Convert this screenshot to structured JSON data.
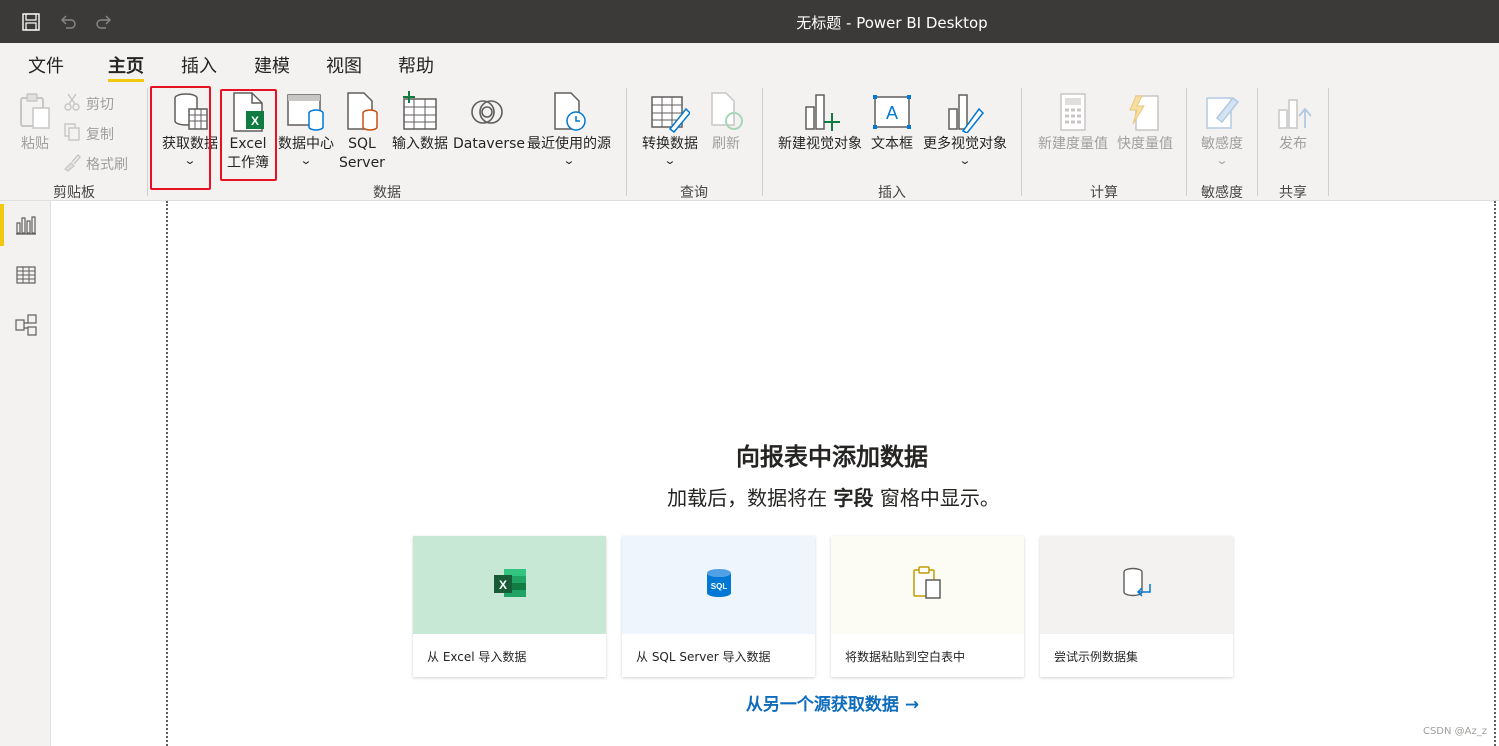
{
  "titlebar": {
    "title": "无标题 - Power BI Desktop",
    "icons": [
      "save-icon",
      "undo-icon",
      "redo-icon"
    ]
  },
  "menu": {
    "tabs": [
      "文件",
      "主页",
      "插入",
      "建模",
      "视图",
      "帮助"
    ],
    "active": "主页"
  },
  "ribbon": {
    "clipboard": {
      "group_label": "剪贴板",
      "paste": "粘贴",
      "cut": "剪切",
      "copy": "复制",
      "format_painter": "格式刷"
    },
    "data": {
      "group_label": "数据",
      "get_data": "获取数据",
      "excel_line1": "Excel",
      "excel_line2": "工作簿",
      "datahub": "数据中心",
      "sql_line1": "SQL",
      "sql_line2": "Server",
      "enter_data": "输入数据",
      "dataverse": "Dataverse",
      "recent_sources": "最近使用的源"
    },
    "query": {
      "group_label": "查询",
      "transform": "转换数据",
      "refresh": "刷新"
    },
    "insert": {
      "group_label": "插入",
      "new_visual": "新建视觉对象",
      "textbox": "文本框",
      "more_visuals": "更多视觉对象"
    },
    "calculations": {
      "group_label": "计算",
      "new_measure": "新建度量值",
      "quick_measure": "快度量值"
    },
    "sensitivity": {
      "group_label": "敏感度",
      "sensitivity": "敏感度"
    },
    "share": {
      "group_label": "共享",
      "publish": "发布"
    }
  },
  "leftnav": {
    "items": [
      "report-view-icon",
      "table-view-icon",
      "model-view-icon"
    ],
    "active": "report-view-icon"
  },
  "main": {
    "heading": "向报表中添加数据",
    "sub_pre": "加载后，数据将在",
    "sub_bold": "字段",
    "sub_post": "窗格中显示。",
    "cards": [
      {
        "label": "从 Excel 导入数据",
        "color": "#c8e8d6"
      },
      {
        "label": "从 SQL Server 导入数据",
        "color": "#eff5fc"
      },
      {
        "label": "将数据粘贴到空白表中",
        "color": "#fcfcf4"
      },
      {
        "label": "尝试示例数据集",
        "color": "#f3f2f1"
      }
    ],
    "more_link": "从另一个源获取数据 →"
  },
  "watermark": "CSDN @Az_z",
  "colors": {
    "accent_yellow": "#f2c811",
    "highlight_red": "#e81123",
    "link_blue": "#0f6cbd",
    "titlebar_bg": "#3b3a39"
  }
}
